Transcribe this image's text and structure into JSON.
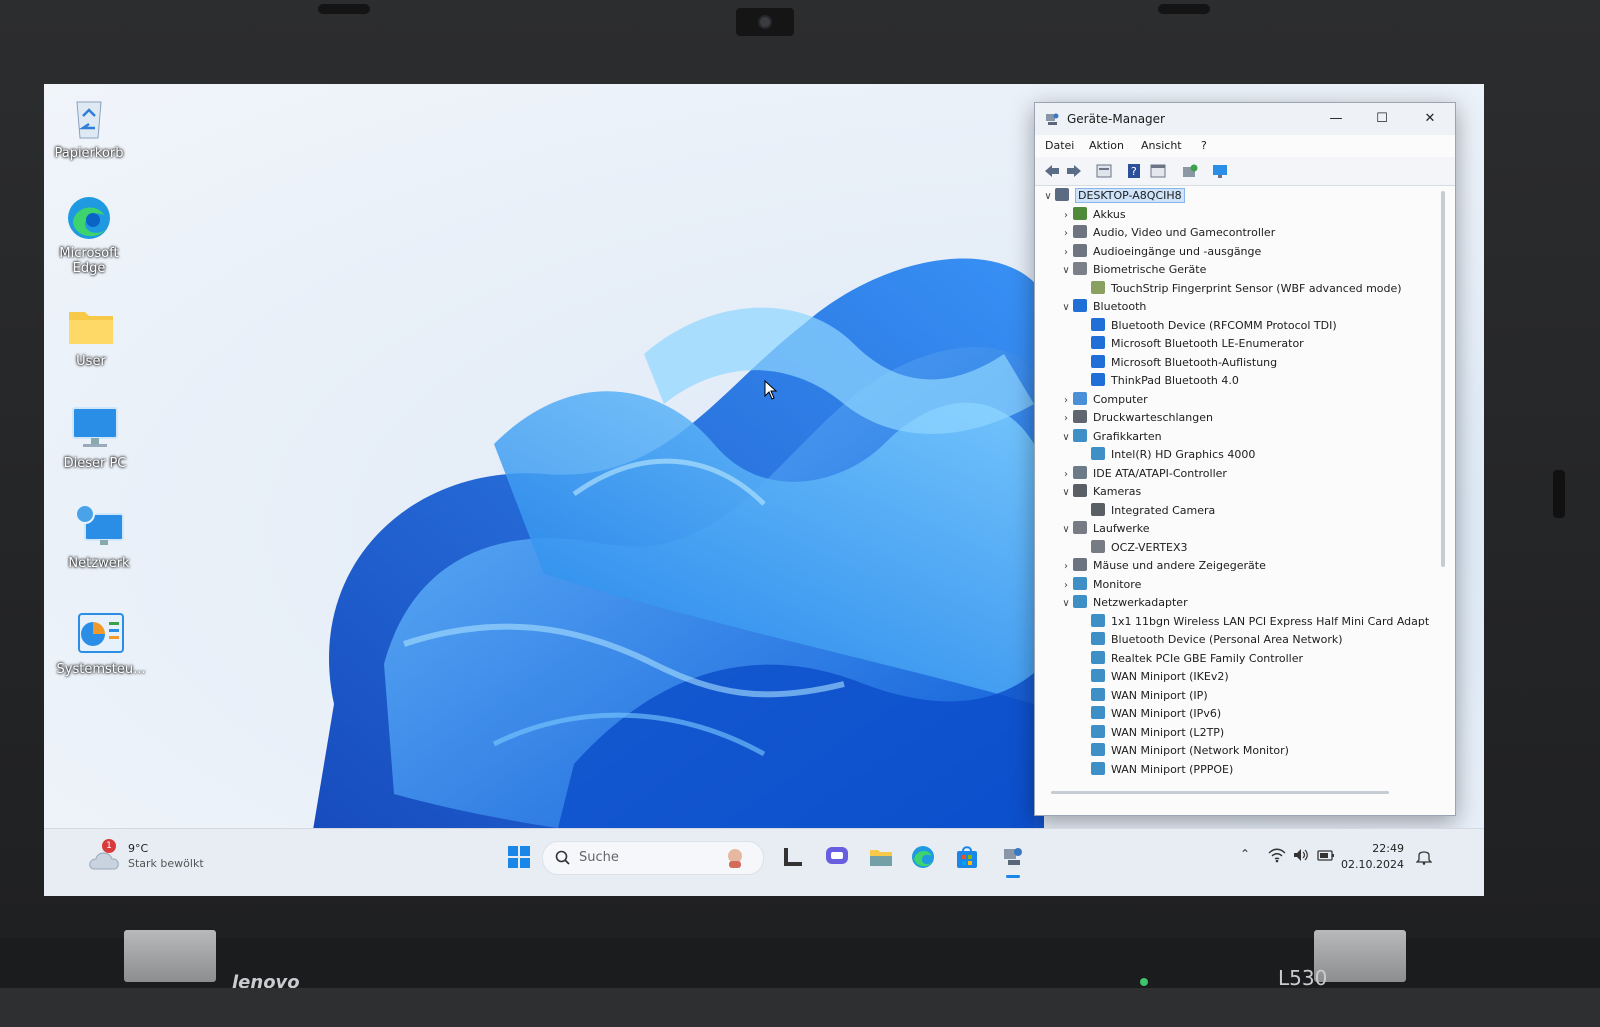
{
  "desktop": {
    "icons": [
      {
        "label": "Papierkorb",
        "icon": "recycle-bin-icon"
      },
      {
        "label": "Microsoft Edge",
        "icon": "edge-icon"
      },
      {
        "label": "User",
        "icon": "folder-icon"
      },
      {
        "label": "Dieser PC",
        "icon": "monitor-icon"
      },
      {
        "label": "Netzwerk",
        "icon": "network-icon"
      },
      {
        "label": "Systemsteu...",
        "icon": "control-panel-icon"
      }
    ]
  },
  "device_manager": {
    "title": "Geräte-Manager",
    "menu": [
      "Datei",
      "Aktion",
      "Ansicht",
      "?"
    ],
    "toolbar_icons": [
      "back-arrow-icon",
      "forward-arrow-icon",
      "properties-icon",
      "help-icon",
      "view-icon",
      "update-driver-icon",
      "monitor-icon"
    ],
    "tree": [
      {
        "label": "DESKTOP-A8QCIH8",
        "level": 0,
        "expand": "open",
        "icon": "computer-icon",
        "color": "#5a6b82",
        "selected": true
      },
      {
        "label": "Akkus",
        "level": 1,
        "expand": "closed",
        "icon": "battery-icon",
        "color": "#4f8a3a"
      },
      {
        "label": "Audio, Video und Gamecontroller",
        "level": 1,
        "expand": "closed",
        "icon": "speaker-icon",
        "color": "#6e7580"
      },
      {
        "label": "Audioeingänge und -ausgänge",
        "level": 1,
        "expand": "closed",
        "icon": "speaker-icon",
        "color": "#6e7580"
      },
      {
        "label": "Biometrische Geräte",
        "level": 1,
        "expand": "open",
        "icon": "biometric-icon",
        "color": "#7b7f88"
      },
      {
        "label": "TouchStrip Fingerprint Sensor (WBF advanced mode)",
        "level": 2,
        "expand": "none",
        "icon": "fingerprint-icon",
        "color": "#8aa060"
      },
      {
        "label": "Bluetooth",
        "level": 1,
        "expand": "open",
        "icon": "bluetooth-icon",
        "color": "#1f6fd6"
      },
      {
        "label": "Bluetooth Device (RFCOMM Protocol TDI)",
        "level": 2,
        "expand": "none",
        "icon": "bluetooth-icon",
        "color": "#1f6fd6"
      },
      {
        "label": "Microsoft Bluetooth LE-Enumerator",
        "level": 2,
        "expand": "none",
        "icon": "bluetooth-icon",
        "color": "#1f6fd6"
      },
      {
        "label": "Microsoft Bluetooth-Auflistung",
        "level": 2,
        "expand": "none",
        "icon": "bluetooth-icon",
        "color": "#1f6fd6"
      },
      {
        "label": "ThinkPad Bluetooth 4.0",
        "level": 2,
        "expand": "none",
        "icon": "bluetooth-icon",
        "color": "#1f6fd6"
      },
      {
        "label": "Computer",
        "level": 1,
        "expand": "closed",
        "icon": "computer-icon",
        "color": "#4a90d9"
      },
      {
        "label": "Druckwarteschlangen",
        "level": 1,
        "expand": "closed",
        "icon": "printer-icon",
        "color": "#5f6670"
      },
      {
        "label": "Grafikkarten",
        "level": 1,
        "expand": "open",
        "icon": "display-adapter-icon",
        "color": "#3f8fc7"
      },
      {
        "label": "Intel(R) HD Graphics 4000",
        "level": 2,
        "expand": "none",
        "icon": "display-adapter-icon",
        "color": "#3f8fc7"
      },
      {
        "label": "IDE ATA/ATAPI-Controller",
        "level": 1,
        "expand": "closed",
        "icon": "controller-icon",
        "color": "#6d7a88"
      },
      {
        "label": "Kameras",
        "level": 1,
        "expand": "open",
        "icon": "camera-icon",
        "color": "#5a5f66"
      },
      {
        "label": "Integrated Camera",
        "level": 2,
        "expand": "none",
        "icon": "camera-icon",
        "color": "#5a5f66"
      },
      {
        "label": "Laufwerke",
        "level": 1,
        "expand": "open",
        "icon": "drive-icon",
        "color": "#777c84"
      },
      {
        "label": "OCZ-VERTEX3",
        "level": 2,
        "expand": "none",
        "icon": "drive-icon",
        "color": "#777c84"
      },
      {
        "label": "Mäuse und andere Zeigegeräte",
        "level": 1,
        "expand": "closed",
        "icon": "mouse-icon",
        "color": "#6b7380"
      },
      {
        "label": "Monitore",
        "level": 1,
        "expand": "closed",
        "icon": "monitor-icon",
        "color": "#3f8fc7"
      },
      {
        "label": "Netzwerkadapter",
        "level": 1,
        "expand": "open",
        "icon": "network-adapter-icon",
        "color": "#3f8fc7"
      },
      {
        "label": "1x1 11bgn Wireless LAN PCI Express Half Mini Card Adapt",
        "level": 2,
        "expand": "none",
        "icon": "network-adapter-icon",
        "color": "#3f8fc7"
      },
      {
        "label": "Bluetooth Device (Personal Area Network)",
        "level": 2,
        "expand": "none",
        "icon": "network-adapter-icon",
        "color": "#3f8fc7"
      },
      {
        "label": "Realtek PCIe GBE Family Controller",
        "level": 2,
        "expand": "none",
        "icon": "network-adapter-icon",
        "color": "#3f8fc7"
      },
      {
        "label": "WAN Miniport (IKEv2)",
        "level": 2,
        "expand": "none",
        "icon": "network-adapter-icon",
        "color": "#3f8fc7"
      },
      {
        "label": "WAN Miniport (IP)",
        "level": 2,
        "expand": "none",
        "icon": "network-adapter-icon",
        "color": "#3f8fc7"
      },
      {
        "label": "WAN Miniport (IPv6)",
        "level": 2,
        "expand": "none",
        "icon": "network-adapter-icon",
        "color": "#3f8fc7"
      },
      {
        "label": "WAN Miniport (L2TP)",
        "level": 2,
        "expand": "none",
        "icon": "network-adapter-icon",
        "color": "#3f8fc7"
      },
      {
        "label": "WAN Miniport (Network Monitor)",
        "level": 2,
        "expand": "none",
        "icon": "network-adapter-icon",
        "color": "#3f8fc7"
      },
      {
        "label": "WAN Miniport (PPPOE)",
        "level": 2,
        "expand": "none",
        "icon": "network-adapter-icon",
        "color": "#3f8fc7"
      }
    ]
  },
  "taskbar": {
    "weather": {
      "badge": "1",
      "temp": "9°C",
      "condition": "Stark bewölkt"
    },
    "search_placeholder": "Suche",
    "pinned": [
      "start-icon",
      "copilot-icon",
      "snap-icon",
      "chat-icon",
      "file-explorer-icon",
      "edge-icon",
      "store-icon",
      "device-manager-icon"
    ],
    "clock_time": "22:49",
    "clock_date": "02.10.2024"
  },
  "laptop": {
    "brand": "lenovo",
    "model": "L530"
  }
}
